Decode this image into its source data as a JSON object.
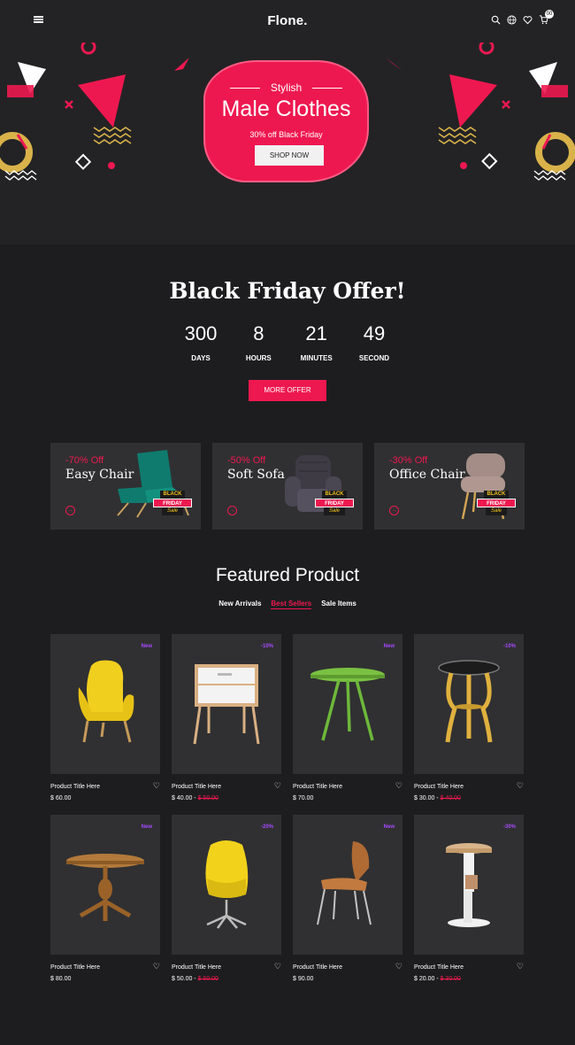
{
  "header": {
    "logo": "Flone.",
    "icons": [
      "menu-icon",
      "search-icon",
      "globe-icon",
      "heart-icon",
      "cart-icon"
    ],
    "cart_count": "00"
  },
  "hero": {
    "subtitle": "Stylish",
    "title": "Male Clothes",
    "offer": "30% off Black Friday",
    "button": "SHOP NOW"
  },
  "offer": {
    "title": "Black Friday Offer!",
    "countdown": [
      {
        "value": "300",
        "label": "DAYS"
      },
      {
        "value": "8",
        "label": "HOURS"
      },
      {
        "value": "21",
        "label": "MINUTES"
      },
      {
        "value": "49",
        "label": "SECOND"
      }
    ],
    "button": "MORE OFFER"
  },
  "banners": [
    {
      "discount": "-70% Off",
      "name": "Easy Chair"
    },
    {
      "discount": "-50% Off",
      "name": "Soft Sofa"
    },
    {
      "discount": "-30% Off",
      "name": "Office Chair"
    }
  ],
  "badge_text": {
    "line1": "BLACK",
    "line2": "FRIDAY",
    "line3": "Sale"
  },
  "featured": {
    "title": "Featured Product",
    "tabs": [
      "New Arrivals",
      "Best Sellers",
      "Sale Items"
    ],
    "active_tab": "Best Sellers"
  },
  "products": [
    {
      "title": "Product Title Here",
      "badge": "New",
      "price": "$ 60.00",
      "old_price": ""
    },
    {
      "title": "Product Title Here",
      "badge": "-10%",
      "price": "$ 40.00",
      "old_price": "$ 50.00"
    },
    {
      "title": "Product Title Here",
      "badge": "New",
      "price": "$ 70.00",
      "old_price": ""
    },
    {
      "title": "Product Title Here",
      "badge": "-10%",
      "price": "$ 30.00",
      "old_price": "$ 40.00"
    },
    {
      "title": "Product Title Here",
      "badge": "New",
      "price": "$ 80.00",
      "old_price": ""
    },
    {
      "title": "Product Title Here",
      "badge": "-20%",
      "price": "$ 50.00",
      "old_price": "$ 60.00"
    },
    {
      "title": "Product Title Here",
      "badge": "New",
      "price": "$ 90.00",
      "old_price": ""
    },
    {
      "title": "Product Title Here",
      "badge": "-30%",
      "price": "$ 20.00",
      "old_price": "$ 30.00"
    }
  ],
  "colors": {
    "accent": "#ee1850",
    "badge": "#a749ff",
    "background": "#1d1d1f",
    "card": "#303032"
  }
}
